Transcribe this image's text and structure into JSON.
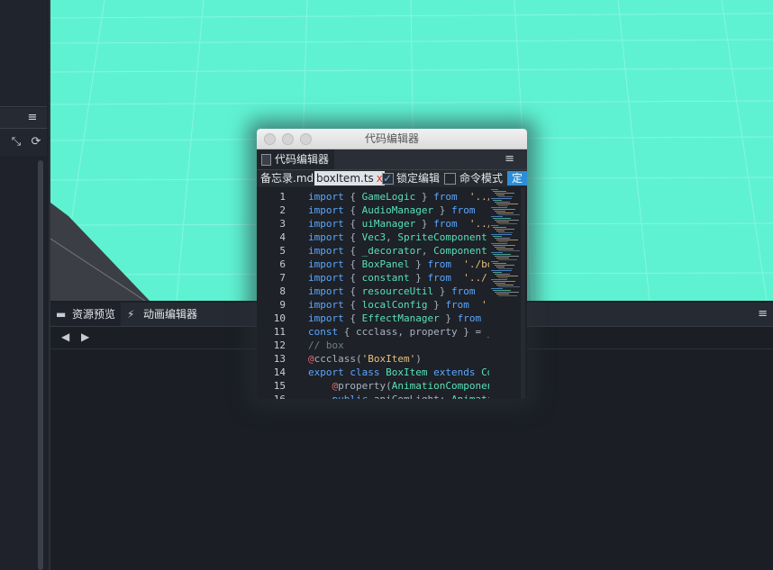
{
  "left_panel": {
    "header_menu_icon": "hamburger-icon",
    "tools": [
      {
        "name": "collapse-icon",
        "glyph": "⤡"
      },
      {
        "name": "refresh-icon",
        "glyph": "⟳"
      }
    ]
  },
  "bottom_panel": {
    "tabs": [
      {
        "label": "资源预览",
        "icon": "folder-icon"
      },
      {
        "label": "动画编辑器",
        "icon": "running-icon"
      }
    ],
    "menu_icon": "hamburger-icon",
    "nav": {
      "back": "◀",
      "forward": "▶"
    }
  },
  "code_editor_window": {
    "title": "代码编辑器",
    "tab_label": "代码编辑器",
    "files": [
      "备忘录.md",
      "boxItem.ts"
    ],
    "close_glyph": "x",
    "lock_edit": {
      "label": "锁定编辑",
      "checked": true
    },
    "command_mode": {
      "label": "命令模式",
      "checked": false
    },
    "save_button": "定",
    "code_lines": [
      {
        "n": "1",
        "tokens": [
          [
            "kw",
            "import"
          ],
          [
            "",
            "{ "
          ],
          [
            "id",
            "GameLogic"
          ],
          [
            "",
            " } "
          ],
          [
            "kw",
            "from"
          ],
          [
            "str",
            " '../."
          ]
        ]
      },
      {
        "n": "2",
        "tokens": [
          [
            "kw",
            "import"
          ],
          [
            "",
            "{ "
          ],
          [
            "id",
            "AudioManager"
          ],
          [
            "",
            " } "
          ],
          [
            "kw",
            "from"
          ],
          [
            "str",
            " '."
          ]
        ]
      },
      {
        "n": "3",
        "tokens": [
          [
            "kw",
            "import"
          ],
          [
            "",
            "{ "
          ],
          [
            "id",
            "uiManager"
          ],
          [
            "",
            " } "
          ],
          [
            "kw",
            "from"
          ],
          [
            "str",
            " '../."
          ]
        ]
      },
      {
        "n": "4",
        "tokens": [
          [
            "kw",
            "import"
          ],
          [
            "",
            "{ "
          ],
          [
            "id",
            "Vec3"
          ],
          [
            "",
            ", "
          ],
          [
            "id",
            "SpriteComponent"
          ],
          [
            "",
            ","
          ]
        ]
      },
      {
        "n": "5",
        "tokens": [
          [
            "kw",
            "import"
          ],
          [
            "",
            "{ "
          ],
          [
            "id",
            "_decorator"
          ],
          [
            "",
            ", "
          ],
          [
            "id",
            "Component"
          ],
          [
            "",
            ","
          ]
        ]
      },
      {
        "n": "6",
        "tokens": [
          [
            "kw",
            "import"
          ],
          [
            "",
            "{ "
          ],
          [
            "id",
            "BoxPanel"
          ],
          [
            "",
            " } "
          ],
          [
            "kw",
            "from"
          ],
          [
            "str",
            " './box"
          ]
        ]
      },
      {
        "n": "7",
        "tokens": [
          [
            "kw",
            "import"
          ],
          [
            "",
            "{ "
          ],
          [
            "id",
            "constant"
          ],
          [
            "",
            " } "
          ],
          [
            "kw",
            "from"
          ],
          [
            "str",
            " '../.."
          ]
        ]
      },
      {
        "n": "8",
        "tokens": [
          [
            "kw",
            "import"
          ],
          [
            "",
            "{ "
          ],
          [
            "id",
            "resourceUtil"
          ],
          [
            "",
            " } "
          ],
          [
            "kw",
            "from"
          ],
          [
            "str",
            " '."
          ]
        ]
      },
      {
        "n": "9",
        "tokens": [
          [
            "kw",
            "import"
          ],
          [
            "",
            "{ "
          ],
          [
            "id",
            "localConfig"
          ],
          [
            "",
            " } "
          ],
          [
            "kw",
            "from"
          ],
          [
            "str",
            " '.."
          ]
        ]
      },
      {
        "n": "10",
        "tokens": [
          [
            "kw",
            "import"
          ],
          [
            "",
            "{ "
          ],
          [
            "id",
            "EffectManager"
          ],
          [
            "",
            " } "
          ],
          [
            "kw",
            "from"
          ],
          [
            "str",
            " '"
          ]
        ]
      },
      {
        "n": "11",
        "tokens": [
          [
            "kw",
            "const"
          ],
          [
            "",
            "{ ccclass, property } = "
          ],
          [
            "id",
            "_"
          ]
        ]
      },
      {
        "n": "12",
        "tokens": [
          [
            "cm",
            "// box"
          ]
        ]
      },
      {
        "n": "13",
        "tokens": [
          [
            "dec",
            "@"
          ],
          [
            "",
            "ccclass("
          ],
          [
            "str",
            "'BoxItem'"
          ],
          [
            "",
            ")"
          ]
        ]
      },
      {
        "n": "14",
        "tokens": [
          [
            "kw",
            "export class "
          ],
          [
            "id",
            "BoxItem "
          ],
          [
            "kw",
            "extends "
          ],
          [
            "id",
            "Co"
          ]
        ]
      },
      {
        "n": "15",
        "tokens": [
          [
            "",
            "    "
          ],
          [
            "dec",
            "@"
          ],
          [
            "",
            "property("
          ],
          [
            "id",
            "AnimationComponen"
          ]
        ]
      },
      {
        "n": "16",
        "tokens": [
          [
            "",
            "    "
          ],
          [
            "kw",
            "public "
          ],
          [
            "",
            "aniComLight: "
          ],
          [
            "id",
            "Animati"
          ]
        ]
      }
    ]
  }
}
